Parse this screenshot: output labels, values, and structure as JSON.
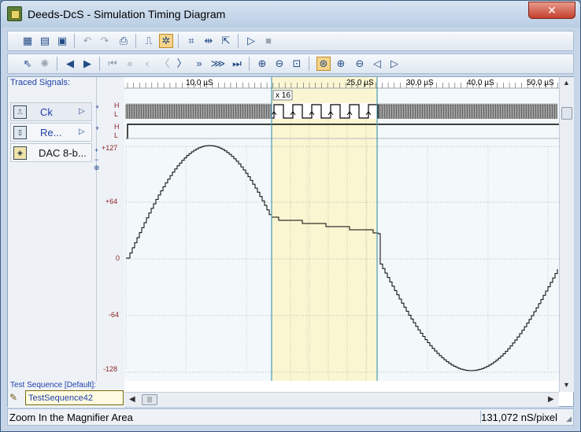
{
  "window": {
    "title": "Deeds-DcS  -  Simulation Timing Diagram",
    "close_glyph": "✕"
  },
  "left_panel": {
    "traced_label": "Traced Signals:",
    "signals": [
      {
        "name": "Ck",
        "icon": "clock-signal-icon"
      },
      {
        "name": "Re...",
        "icon": "reset-signal-icon"
      },
      {
        "name": "DAC 8-b...",
        "icon": "dac-signal-icon"
      }
    ]
  },
  "scale": {
    "digital_high": "H",
    "digital_low": "L",
    "analog": [
      "+127",
      "+64",
      "0",
      "-64",
      "-128"
    ]
  },
  "ruler": {
    "labels": [
      "10,0 µS",
      "25,0 µS",
      "30,0 µS",
      "40,0 µS",
      "50,0 µS"
    ]
  },
  "magnifier": {
    "label": "x 16"
  },
  "test_sequence": {
    "label": "Test Sequence [Default]:",
    "value": "TestSequence42"
  },
  "status": {
    "message": "Zoom In the Magnifier Area",
    "resolution": "131,072 nS/pixel"
  },
  "colors": {
    "accent": "#1f3fa8",
    "scale_red": "#8b1d1d",
    "magnifier_fill": "#fbf6d2",
    "plot_bg": "#f3f8fa"
  }
}
